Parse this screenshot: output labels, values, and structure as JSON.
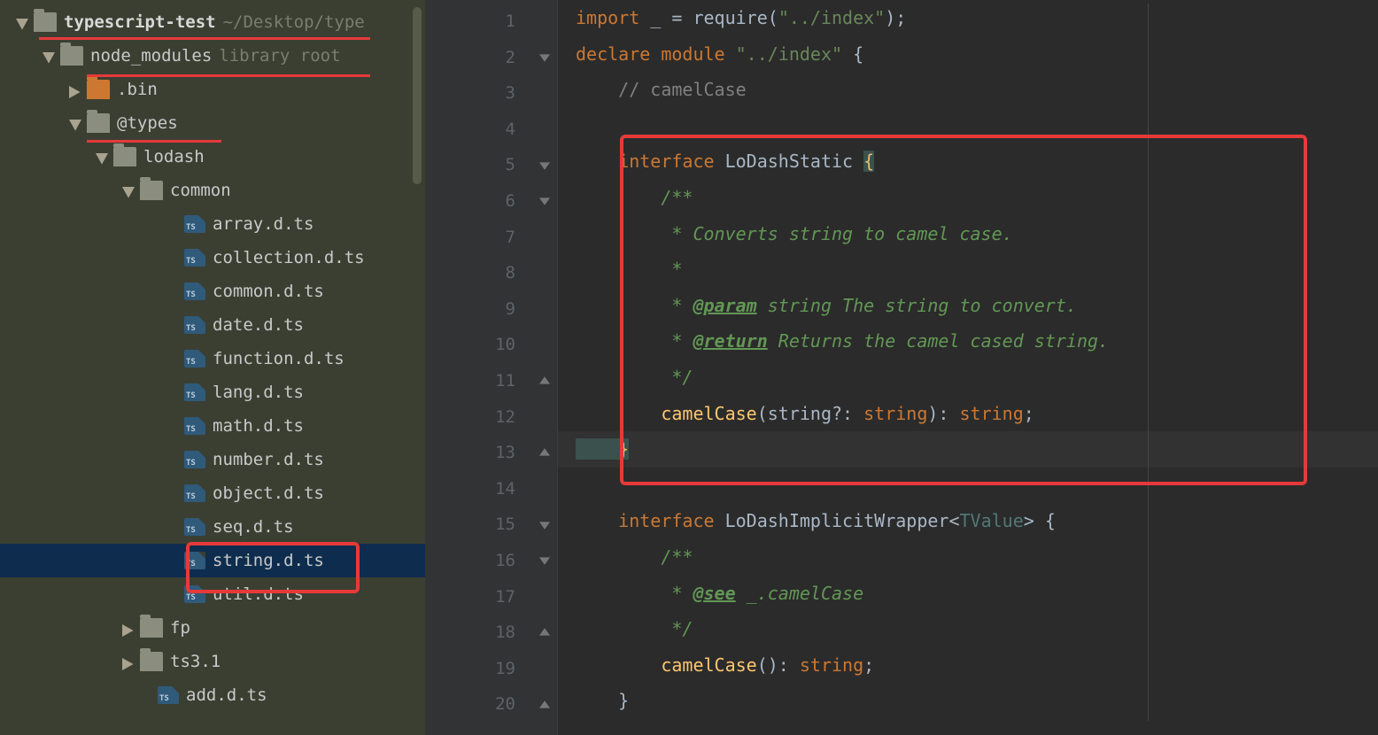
{
  "project": {
    "name": "typescript-test",
    "path": "~/Desktop/type"
  },
  "tree": {
    "node_modules": {
      "label": "node_modules",
      "tag": "library root"
    },
    "bin": ".bin",
    "atypes": "@types",
    "lodash": "lodash",
    "common": "common",
    "files": {
      "array": "array.d.ts",
      "collection": "collection.d.ts",
      "commonf": "common.d.ts",
      "date": "date.d.ts",
      "function": "function.d.ts",
      "lang": "lang.d.ts",
      "math": "math.d.ts",
      "number": "number.d.ts",
      "object": "object.d.ts",
      "seq": "seq.d.ts",
      "string": "string.d.ts",
      "util": "util.d.ts"
    },
    "fp": "fp",
    "ts31": "ts3.1",
    "addts": "add.d.ts"
  },
  "line_numbers": [
    "1",
    "2",
    "3",
    "4",
    "5",
    "6",
    "7",
    "8",
    "9",
    "10",
    "11",
    "12",
    "13",
    "14",
    "15",
    "16",
    "17",
    "18",
    "19",
    "20"
  ],
  "code": {
    "l1": {
      "a": "import ",
      "b": "_ ",
      "c": "= require(",
      "d": "\"../index\"",
      "e": ");"
    },
    "l2": {
      "a": "declare module ",
      "b": "\"../index\" ",
      "c": "{"
    },
    "l3": "    // camelCase",
    "l5": {
      "a": "    interface ",
      "b": "LoDashStatic ",
      "c": "{"
    },
    "l6": "        /**",
    "l7": "         * Converts string to camel case.",
    "l8": "         *",
    "l9": {
      "a": "         * ",
      "b": "@param",
      "c": " string The string to convert."
    },
    "l10": {
      "a": "         * ",
      "b": "@return",
      "c": " Returns the camel cased string."
    },
    "l11": "         */",
    "l12": {
      "a": "        ",
      "b": "camelCase",
      "c": "(string?: ",
      "d": "string",
      "e": "): ",
      "f": "string",
      "g": ";"
    },
    "l13": "    }",
    "l15": {
      "a": "    interface ",
      "b": "LoDashImplicitWrapper",
      "c": "<",
      "d": "TValue",
      "e": "> {"
    },
    "l16": "        /**",
    "l17": {
      "a": "         * ",
      "b": "@see",
      "c": " _.camelCase"
    },
    "l18": "         */",
    "l19": {
      "a": "        ",
      "b": "camelCase",
      "c": "(): ",
      "d": "string",
      "e": ";"
    },
    "l20": "    }"
  }
}
